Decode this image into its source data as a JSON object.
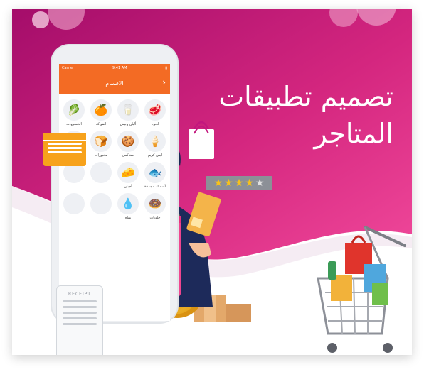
{
  "headline": {
    "line1": "تصميم تطبيقات",
    "line2": "المتاجر"
  },
  "phone": {
    "carrier": "Carrier",
    "time": "9:41 AM",
    "title": "الاقسام",
    "categories": [
      {
        "label": "لحوم",
        "icon": "meat-icon",
        "glyph": "🥩"
      },
      {
        "label": "ألبان وبيض",
        "icon": "dairy-icon",
        "glyph": "🥛"
      },
      {
        "label": "الفواكه",
        "icon": "fruits-icon",
        "glyph": "🍊"
      },
      {
        "label": "الخضروات",
        "icon": "vegetables-icon",
        "glyph": "🥬"
      },
      {
        "label": "آيس كريم",
        "icon": "ice-cream-icon",
        "glyph": "🍦"
      },
      {
        "label": "سناكس",
        "icon": "snacks-icon",
        "glyph": "🍪"
      },
      {
        "label": "مخبوزات",
        "icon": "bread-icon",
        "glyph": "🍞"
      },
      {
        "label": "",
        "icon": "blank-icon",
        "glyph": ""
      },
      {
        "label": "أسماك مجمدة",
        "icon": "fish-icon",
        "glyph": "🐟"
      },
      {
        "label": "أجبان",
        "icon": "cheese-icon",
        "glyph": "🧀"
      },
      {
        "label": "",
        "icon": "blank-icon",
        "glyph": ""
      },
      {
        "label": "",
        "icon": "blank-icon",
        "glyph": ""
      },
      {
        "label": "حلويات",
        "icon": "donut-icon",
        "glyph": "🍩"
      },
      {
        "label": "مياه",
        "icon": "water-icon",
        "glyph": "💧"
      },
      {
        "label": "",
        "icon": "blank-icon",
        "glyph": ""
      },
      {
        "label": "",
        "icon": "blank-icon",
        "glyph": ""
      }
    ]
  },
  "rating": {
    "filled": 4,
    "total": 5
  },
  "receipt": {
    "title": "RECEIPT"
  },
  "colors": {
    "magenta": "#c2177e",
    "pink": "#e2338f",
    "orange": "#f36b24",
    "gold": "#f7a21b"
  }
}
